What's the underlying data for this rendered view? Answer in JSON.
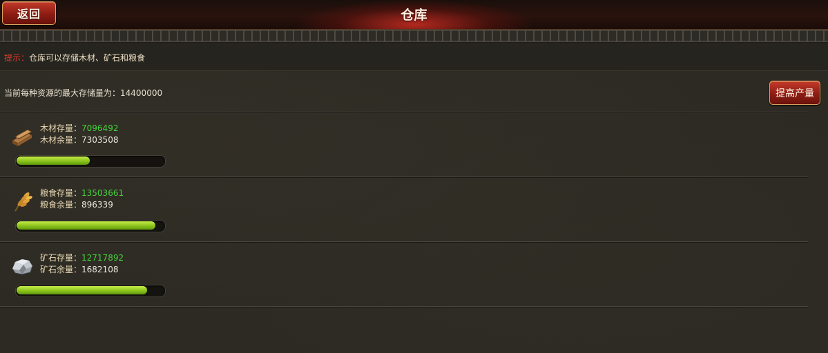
{
  "header": {
    "back_label": "返回",
    "title": "仓库"
  },
  "tip": {
    "label": "提示：",
    "text": "仓库可以存储木材、矿石和粮食"
  },
  "capacity": {
    "text": "当前每种资源的最大存储量为：",
    "value": "14400000"
  },
  "raise_button": "提高产量",
  "resources": [
    {
      "icon": "wood-icon",
      "stored_label": "木材存量：",
      "stored_value": "7096492",
      "remain_label": "木材余量：",
      "remain_value": "7303508",
      "fill_fraction": 0.493
    },
    {
      "icon": "grain-icon",
      "stored_label": "粮食存量：",
      "stored_value": "13503661",
      "remain_label": "粮食余量：",
      "remain_value": "896339",
      "fill_fraction": 0.938
    },
    {
      "icon": "ore-icon",
      "stored_label": "矿石存量：",
      "stored_value": "12717892",
      "remain_label": "矿石余量：",
      "remain_value": "1682108",
      "fill_fraction": 0.883
    }
  ],
  "colors": {
    "accent_red": "#8e1d13",
    "progress_green": "#8cc21c",
    "value_green": "#46d33c",
    "tip_red": "#e23a2a"
  }
}
